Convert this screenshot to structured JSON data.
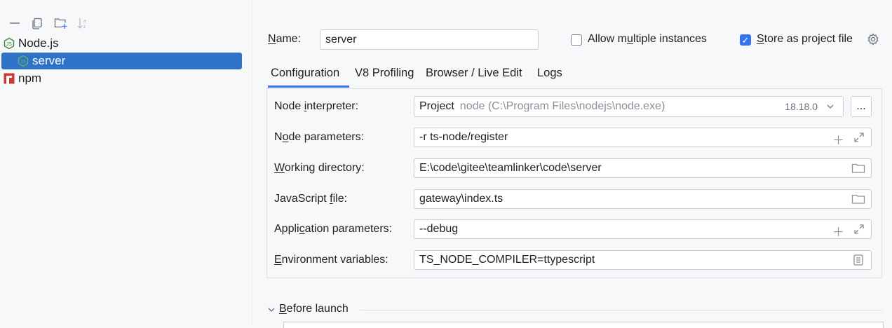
{
  "sidebar": {
    "toolbar": [
      "minus-icon",
      "copy-icon",
      "add-folder-icon",
      "sort-icon"
    ],
    "tree": [
      {
        "label": "Node.js",
        "icon": "nodejs-icon"
      },
      {
        "label": "server",
        "icon": "nodejs-icon",
        "selected": true
      },
      {
        "label": "npm",
        "icon": "npm-icon"
      }
    ]
  },
  "config": {
    "name_label": "Name:",
    "name_value": "server",
    "allow_multiple": {
      "label": "Allow multiple instances",
      "checked": false
    },
    "store_project": {
      "label": "Store as project file",
      "checked": true
    },
    "tabs": [
      "Configuration",
      "V8 Profiling",
      "Browser / Live Edit",
      "Logs"
    ],
    "active_tab": "Configuration",
    "fields": {
      "interpreter": {
        "label": "Node interpreter:",
        "prefix": "Project",
        "hint": "node (C:\\Program Files\\nodejs\\node.exe)",
        "version": "18.18.0",
        "more": "..."
      },
      "node_params": {
        "label": "Node parameters:",
        "value": "-r ts-node/register"
      },
      "working_dir": {
        "label": "Working directory:",
        "value": "E:\\code\\gitee\\teamlinker\\code\\server"
      },
      "js_file": {
        "label": "JavaScript file:",
        "value": "gateway\\index.ts"
      },
      "app_params": {
        "label": "Application parameters:",
        "value": "--debug"
      },
      "env_vars": {
        "label": "Environment variables:",
        "value": "TS_NODE_COMPILER=ttypescript"
      }
    },
    "before_launch": "Before launch"
  },
  "colors": {
    "accent": "#3574f0",
    "selection": "#2e73c8",
    "nodejs": "#3c873a",
    "npm": "#cb3837"
  }
}
